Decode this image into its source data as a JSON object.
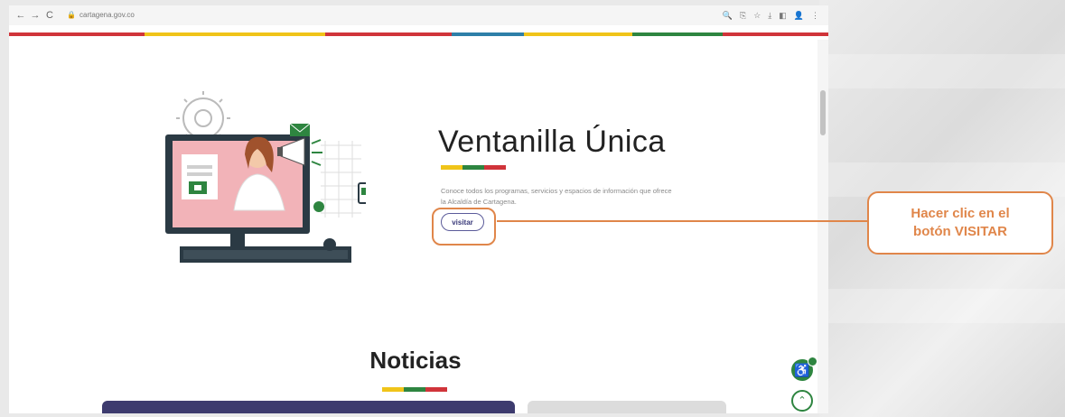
{
  "browser": {
    "url": "cartagena.gov.co",
    "nav_back": "←",
    "nav_forward": "→",
    "nav_reload": "C",
    "lock_icon": "🔒",
    "toolbar_icons": [
      "🔍",
      "⎘",
      "☆",
      "⤓",
      "◧",
      "👤",
      "⋮"
    ]
  },
  "hero": {
    "title": "Ventanilla Única",
    "description": "Conoce todos los programas, servicios y espacios de información que ofrece la Alcaldía de Cartagena.",
    "button_label": "visitar"
  },
  "news": {
    "title": "Noticias"
  },
  "callout": {
    "text": "Hacer clic en el\nbotón VISITAR"
  },
  "widgets": {
    "accessibility_icon": "accessibility-icon",
    "scroll_up_icon": "chevron-up-icon"
  },
  "colors": {
    "yellow": "#f0c419",
    "green": "#2e8540",
    "red": "#d0343a",
    "accent": "#e0864a",
    "navy": "#3d3b6e"
  }
}
